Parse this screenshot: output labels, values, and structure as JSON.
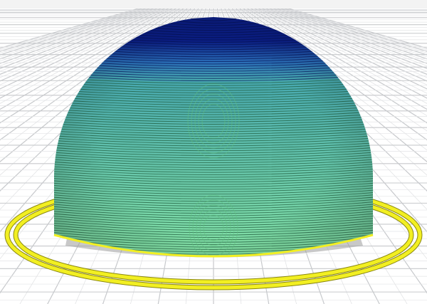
{
  "viewport": {
    "kind": "3d-slicer-layer-preview",
    "object": "dome",
    "background_color": "#ffffff",
    "grid_major_color": "#c7c9cc",
    "grid_minor_color": "#e3e4e6",
    "top_bar_color": "#f3f3f3"
  },
  "object_colors": {
    "top": "#0b1f8a",
    "upper": "#2a6fb8",
    "transition": "#47a8b0",
    "body": "#86e3a6",
    "body_edge": "#5fc27f",
    "line": "#1d5a3a",
    "line_top": "#051254"
  },
  "skirt": {
    "color": "#f2ef22",
    "edge_color": "#8a8710",
    "loops": 2
  }
}
